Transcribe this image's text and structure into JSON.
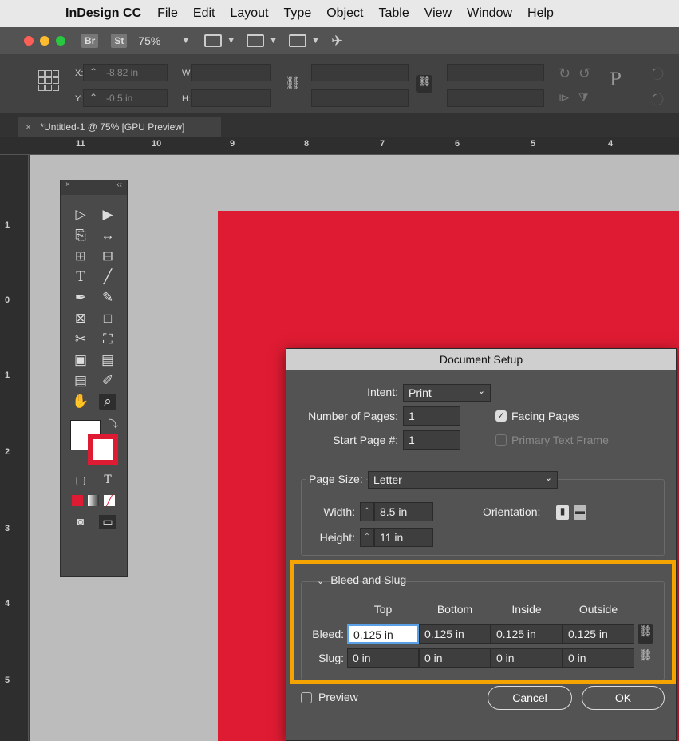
{
  "menubar": {
    "apple_glyph": "",
    "app_name": "InDesign CC",
    "items": [
      "File",
      "Edit",
      "Layout",
      "Type",
      "Object",
      "Table",
      "View",
      "Window",
      "Help"
    ]
  },
  "appbar": {
    "br_label": "Br",
    "st_label": "St",
    "zoom": "75%"
  },
  "control": {
    "x_label": "X:",
    "x_value": "-8.82 in",
    "y_label": "Y:",
    "y_value": "-0.5 in",
    "w_label": "W:",
    "h_label": "H:"
  },
  "doc_tab": {
    "close": "×",
    "title": "*Untitled-1 @ 75% [GPU Preview]"
  },
  "ruler": {
    "h_labels": [
      "11",
      "10",
      "9",
      "8",
      "7",
      "6",
      "5",
      "4"
    ],
    "v_labels": [
      "1",
      "0",
      "1",
      "2",
      "3",
      "4",
      "5"
    ]
  },
  "dialog": {
    "title": "Document Setup",
    "intent_label": "Intent:",
    "intent_value": "Print",
    "num_pages_label": "Number of Pages:",
    "num_pages_value": "1",
    "start_page_label": "Start Page #:",
    "start_page_value": "1",
    "facing_pages_label": "Facing Pages",
    "facing_pages_checked": true,
    "primary_text_frame_label": "Primary Text Frame",
    "page_size_label": "Page Size:",
    "page_size_value": "Letter",
    "width_label": "Width:",
    "width_value": "8.5 in",
    "height_label": "Height:",
    "height_value": "11 in",
    "orientation_label": "Orientation:",
    "bleed_slug_title": "Bleed and Slug",
    "columns": [
      "Top",
      "Bottom",
      "Inside",
      "Outside"
    ],
    "bleed_label": "Bleed:",
    "bleed_values": [
      "0.125 in",
      "0.125 in",
      "0.125 in",
      "0.125 in"
    ],
    "slug_label": "Slug:",
    "slug_values": [
      "0 in",
      "0 in",
      "0 in",
      "0 in"
    ],
    "preview_label": "Preview",
    "cancel_label": "Cancel",
    "ok_label": "OK"
  },
  "colors": {
    "page_red": "#de1b32",
    "highlight": "#f5a300",
    "traffic_red": "#fe5f57",
    "traffic_yellow": "#febc2e",
    "traffic_green": "#28c840"
  }
}
